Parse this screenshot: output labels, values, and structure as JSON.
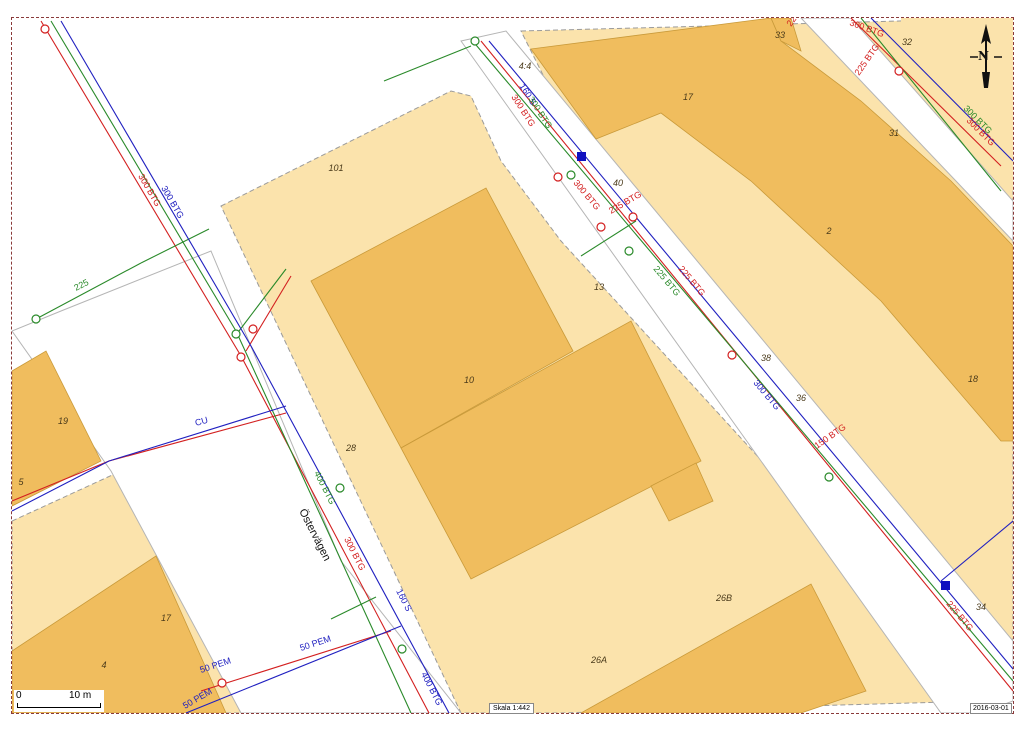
{
  "map": {
    "street_name": "Östervägen",
    "scale_text": "Skala 1:442",
    "date_text": "2016-03-01",
    "north_label": "N",
    "scalebar": {
      "zero": "0",
      "ten": "10 m"
    },
    "parcels": [
      "101",
      "10",
      "13",
      "28",
      "17",
      "31",
      "2",
      "32",
      "33",
      "40",
      "38",
      "36",
      "18",
      "19",
      "5",
      "17",
      "4",
      "26B",
      "26A",
      "34",
      "4:4"
    ],
    "pipe_labels": [
      "300 BTG",
      "300 BTG",
      "225",
      "CU",
      "400 BTG",
      "300 BTG",
      "160 S",
      "50 PEM",
      "50 PEM",
      "50 PEM",
      "400 BTG",
      "160 S",
      "300 BTG",
      "300 BTG",
      "300 BTG",
      "225 BTG",
      "225 BTG",
      "225 BTG",
      "300 BTG",
      "150 BTG",
      "225 BTG",
      "300 BTG",
      "300 BTG",
      "300 BTG",
      "225 BTG",
      "225 BTG"
    ],
    "colors": {
      "building": "#f0bd5e",
      "plot": "#fbe3ac",
      "road": "#ffffff",
      "water": "#d32020",
      "sewer": "#2a8a2a",
      "storm": "#2020c0"
    }
  }
}
